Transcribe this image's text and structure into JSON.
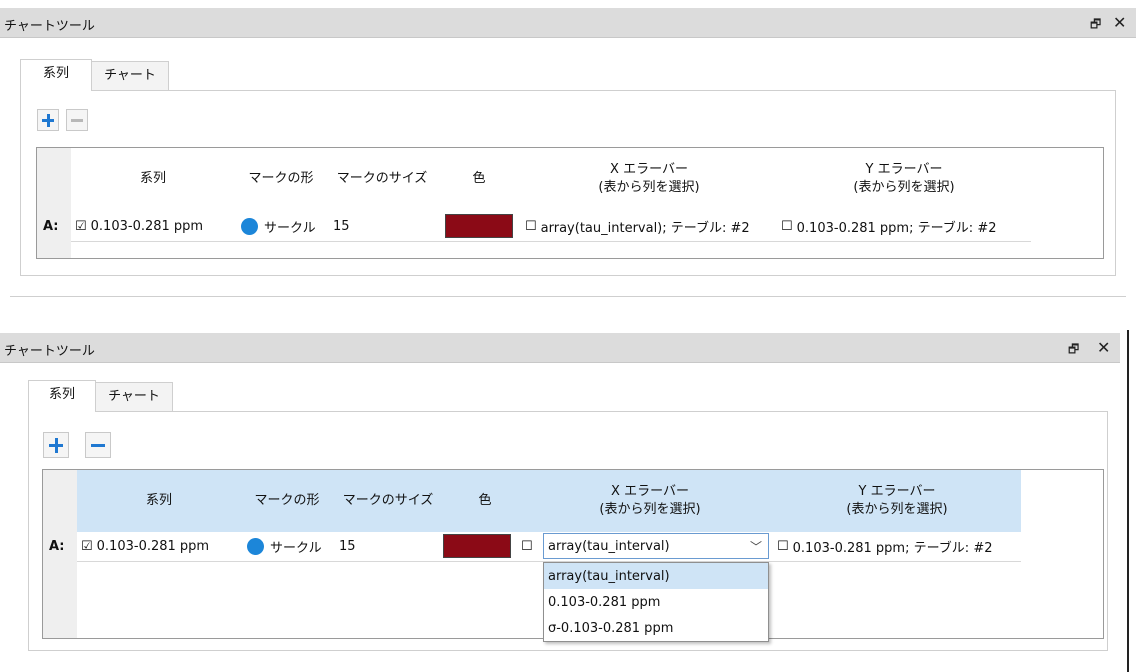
{
  "colors": {
    "accent": "#1f78d1",
    "series_color": "#8b0a16",
    "header_selected": "#cfe4f6",
    "marker": "#1c86d9"
  },
  "icons": {
    "float": "window-restore-icon",
    "close": "close-icon",
    "add": "plus-icon",
    "remove": "minus-icon",
    "marker": "circle-icon"
  },
  "panels": [
    {
      "title": "チャートツール",
      "float_glyph": "🗗",
      "close_glyph": "✕",
      "tabs": [
        "系列",
        "チャート"
      ],
      "headers": {
        "series": "系列",
        "mark_shape": "マークの形",
        "mark_size": "マークのサイズ",
        "color": "色",
        "xerr_line1": "X エラーバー",
        "xerr_line2": "(表から列を選択)",
        "yerr_line1": "Y エラーバー",
        "yerr_line2": "(表から列を選択)"
      },
      "row": {
        "label": "A:",
        "checkbox": "☑",
        "series": "0.103-0.281 ppm",
        "mark_shape": "サークル",
        "mark_size": "15",
        "xerr_checkbox": "☐",
        "xerr": "array(tau_interval); テーブル: #2",
        "yerr_checkbox": "☐",
        "yerr": "0.103-0.281 ppm; テーブル: #2"
      }
    },
    {
      "title": "チャートツール",
      "float_glyph": "🗗",
      "close_glyph": "✕",
      "tabs": [
        "系列",
        "チャート"
      ],
      "headers": {
        "series": "系列",
        "mark_shape": "マークの形",
        "mark_size": "マークのサイズ",
        "color": "色",
        "xerr_line1": "X エラーバー",
        "xerr_line2": "(表から列を選択)",
        "yerr_line1": "Y エラーバー",
        "yerr_line2": "(表から列を選択)"
      },
      "row": {
        "label": "A:",
        "checkbox": "☑",
        "series": "0.103-0.281 ppm",
        "mark_shape": "サークル",
        "mark_size": "15",
        "xerr_checkbox": "☐",
        "xerr_selected": "array(tau_interval)",
        "combo_arrow": "﹀",
        "yerr_checkbox": "☐",
        "yerr": "0.103-0.281 ppm; テーブル: #2"
      },
      "dropdown_options": [
        "array(tau_interval)",
        "0.103-0.281 ppm",
        "σ-0.103-0.281 ppm"
      ]
    }
  ]
}
